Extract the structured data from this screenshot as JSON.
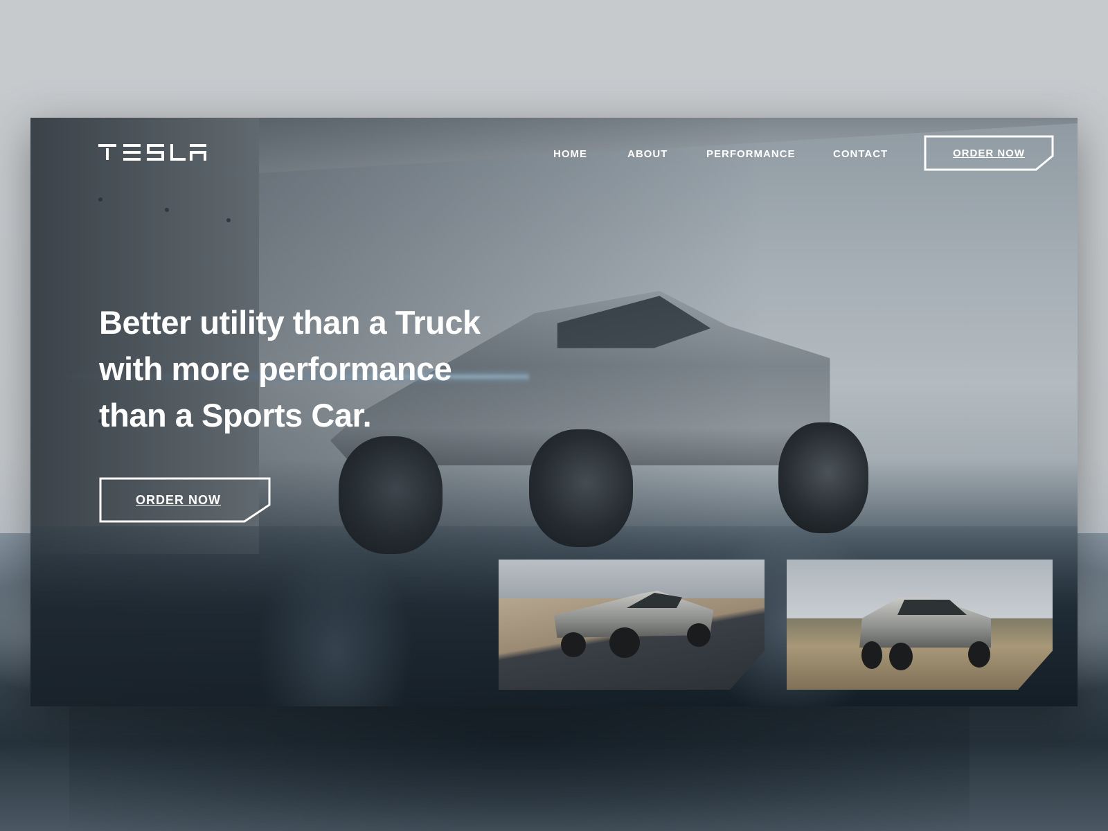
{
  "brand": {
    "logo_text": "TESLA"
  },
  "nav": {
    "home": "HOME",
    "about": "ABOUT",
    "performance": "PERFORMANCE",
    "contact": "CONTACT",
    "order_button": "ORDER NOW"
  },
  "hero": {
    "headline_line1": "Better utility than a Truck",
    "headline_line2": "with more performance",
    "headline_line3": "than a Sports Car.",
    "cta_label": "ORDER NOW"
  },
  "gallery": [
    {
      "subject": "cybertruck-on-track"
    },
    {
      "subject": "cybertruck-in-desert"
    }
  ],
  "colors": {
    "text": "#ffffff",
    "button_border": "#ffffff",
    "page_bg": "#c6c9cc"
  }
}
